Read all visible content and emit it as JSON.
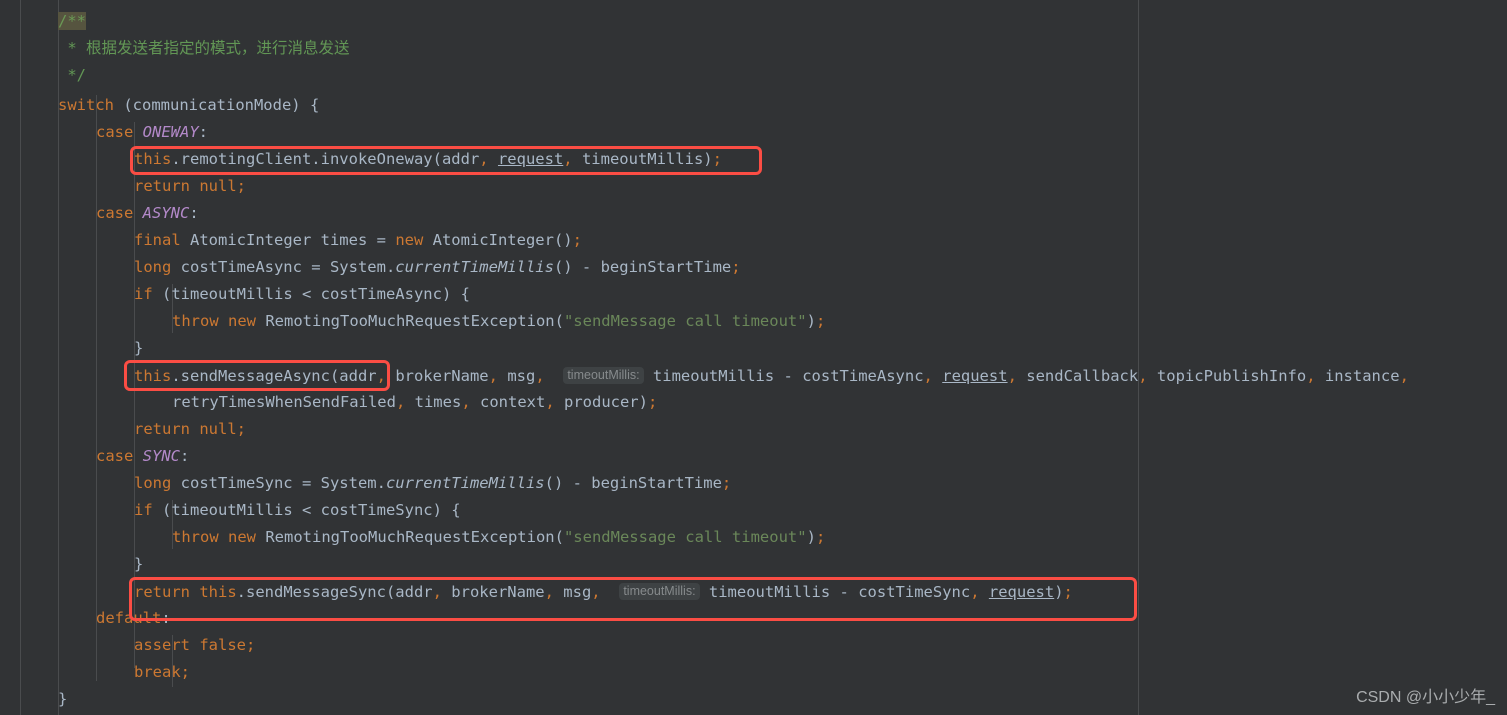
{
  "editor": {
    "background": "#313335",
    "default_text_color": "#a9b7c6",
    "margin_guide_color": "#4a4c4e",
    "accent_annotation_color": "#fb4d44",
    "inlay_hint_bg": "#3e4244",
    "inlay_hint_fg": "#868a8c",
    "search_highlight_bg": "#56543f",
    "keyword_color": "#cc7832",
    "comment_color": "#629755",
    "string_color": "#6a8759",
    "enum_constant_color": "#b389c9"
  },
  "code": {
    "language": "java",
    "lines": [
      {
        "n": 1,
        "indent": 4,
        "text": "/**"
      },
      {
        "n": 2,
        "indent": 4,
        "text": " * 根据发送者指定的模式，进行消息发送"
      },
      {
        "n": 3,
        "indent": 4,
        "text": " */"
      },
      {
        "n": 4,
        "indent": 4,
        "text": "switch (communicationMode) {"
      },
      {
        "n": 5,
        "indent": 8,
        "text": "case ONEWAY:"
      },
      {
        "n": 6,
        "indent": 12,
        "text": "this.remotingClient.invokeOneway(addr, request, timeoutMillis);"
      },
      {
        "n": 7,
        "indent": 12,
        "text": "return null;"
      },
      {
        "n": 8,
        "indent": 8,
        "text": "case ASYNC:"
      },
      {
        "n": 9,
        "indent": 12,
        "text": "final AtomicInteger times = new AtomicInteger();"
      },
      {
        "n": 10,
        "indent": 12,
        "text": "long costTimeAsync = System.currentTimeMillis() - beginStartTime;"
      },
      {
        "n": 11,
        "indent": 12,
        "text": "if (timeoutMillis < costTimeAsync) {"
      },
      {
        "n": 12,
        "indent": 16,
        "text": "throw new RemotingTooMuchRequestException(\"sendMessage call timeout\");"
      },
      {
        "n": 13,
        "indent": 12,
        "text": "}"
      },
      {
        "n": 14,
        "indent": 12,
        "text": "this.sendMessageAsync(addr, brokerName, msg, timeoutMillis: timeoutMillis - costTimeAsync, request, sendCallback, topicPublishInfo, instance,"
      },
      {
        "n": 15,
        "indent": 16,
        "text": "retryTimesWhenSendFailed, times, context, producer);"
      },
      {
        "n": 16,
        "indent": 12,
        "text": "return null;"
      },
      {
        "n": 17,
        "indent": 8,
        "text": "case SYNC:"
      },
      {
        "n": 18,
        "indent": 12,
        "text": "long costTimeSync = System.currentTimeMillis() - beginStartTime;"
      },
      {
        "n": 19,
        "indent": 12,
        "text": "if (timeoutMillis < costTimeSync) {"
      },
      {
        "n": 20,
        "indent": 16,
        "text": "throw new RemotingTooMuchRequestException(\"sendMessage call timeout\");"
      },
      {
        "n": 21,
        "indent": 12,
        "text": "}"
      },
      {
        "n": 22,
        "indent": 12,
        "text": "return this.sendMessageSync(addr, brokerName, msg, timeoutMillis: timeoutMillis - costTimeSync, request);"
      },
      {
        "n": 23,
        "indent": 8,
        "text": "default:"
      },
      {
        "n": 24,
        "indent": 12,
        "text": "assert false;"
      },
      {
        "n": 25,
        "indent": 12,
        "text": "break;"
      },
      {
        "n": 26,
        "indent": 4,
        "text": "}"
      }
    ],
    "inlay_hints": [
      {
        "label": "timeoutMillis:",
        "on_line": 14
      },
      {
        "label": "timeoutMillis:",
        "on_line": 22
      }
    ],
    "highlighted_token": "/**"
  },
  "annotations": {
    "boxes": [
      {
        "id": "box-invoke-oneway",
        "label": "this.remotingClient.invokeOneway(addr, request, timeoutMillis);"
      },
      {
        "id": "box-send-message-async",
        "label": "this.sendMessageAsync(addr"
      },
      {
        "id": "box-send-message-sync",
        "label": "return this.sendMessageSync(addr, brokerName, msg, timeoutMillis: timeoutMillis - costTimeSync, request);"
      }
    ]
  },
  "watermark": {
    "text": "CSDN @小小少年_"
  }
}
